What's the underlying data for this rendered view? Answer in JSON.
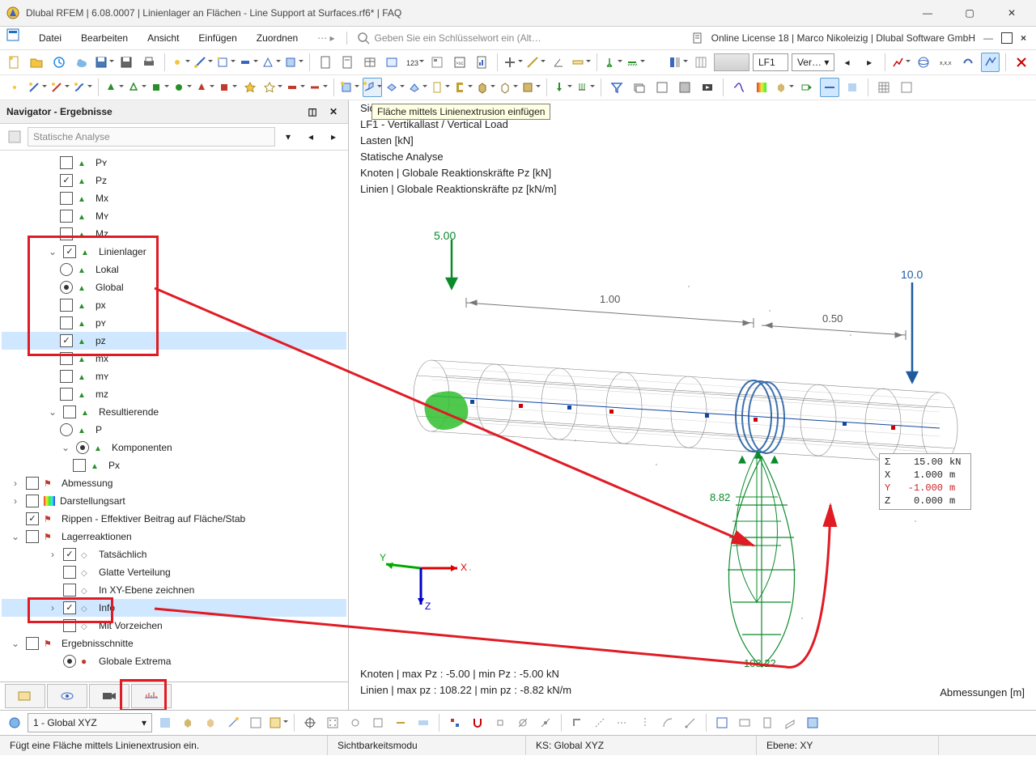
{
  "title": "Dlubal RFEM | 6.08.0007 | Linienlager an Flächen - Line Support at Surfaces.rf6* | FAQ",
  "menu": [
    "Datei",
    "Bearbeiten",
    "Ansicht",
    "Einfügen",
    "Zuordnen"
  ],
  "search_placeholder": "Geben Sie ein Schlüsselwort ein (Alt…",
  "license": "Online License 18 | Marco Nikoleizig | Dlubal Software GmbH",
  "tooltip": "Fläche mittels Linienextrusion einfügen",
  "lf_label": "LF1",
  "lf_value": "Ver…",
  "navigator": {
    "title": "Navigator - Ergebnisse",
    "combo": "Statische Analyse",
    "items": {
      "py": "Pʏ",
      "pz": "Pᴢ",
      "mx": "Mx",
      "my": "Mʏ",
      "mz": "Mᴢ",
      "linienlager": "Linienlager",
      "lokal": "Lokal",
      "global": "Global",
      "spx": "px",
      "spy": "pʏ",
      "spz": "pᴢ",
      "smx": "mx",
      "smy": "mʏ",
      "smz": "mᴢ",
      "resultierende": "Resultierende",
      "p": "P",
      "komponenten": "Komponenten",
      "pxk": "Px",
      "abmessung": "Abmessung",
      "darstellungsart": "Darstellungsart",
      "rippen": "Rippen - Effektiver Beitrag auf Fläche/Stab",
      "lagerreaktionen": "Lagerreaktionen",
      "tatsaechlich": "Tatsächlich",
      "glatte": "Glatte Verteilung",
      "inxy": "In XY-Ebene zeichnen",
      "info": "Info",
      "mitvor": "Mit Vorzeichen",
      "ergebnisschnitte": "Ergebnisschnitte",
      "globext": "Globale Extrema"
    }
  },
  "viewport": {
    "lines": [
      "Sichtbarkeitsmodus",
      "LF1 - Vertikallast / Vertical Load",
      "Lasten [kN]",
      "Statische Analyse",
      "Knoten | Globale Reaktionskräfte Pᴢ [kN]",
      "Linien | Globale Reaktionskräfte pᴢ [kN/m]"
    ],
    "load_left": "5.00",
    "load_right": "10.0",
    "dim1": "1.00",
    "dim2": "0.50",
    "reaction_left": "8.82",
    "reaction_right": "108.22",
    "valbox": [
      {
        "l": "Σ",
        "n": "15.00",
        "u": "kN",
        "cls": ""
      },
      {
        "l": "X",
        "n": "1.000",
        "u": "m",
        "cls": ""
      },
      {
        "l": "Y",
        "n": "-1.000",
        "u": "m",
        "cls": "red"
      },
      {
        "l": "Z",
        "n": "0.000",
        "u": "m",
        "cls": ""
      }
    ],
    "bottom_lines": [
      "Knoten | max Pᴢ : -5.00 | min Pᴢ : -5.00 kN",
      "Linien | max pᴢ : 108.22 | min pᴢ : -8.82 kN/m"
    ],
    "corner": "Abmessungen [m]"
  },
  "bottom_combo": "1 - Global XYZ",
  "status": {
    "hint": "Fügt eine Fläche mittels Linienextrusion ein.",
    "mode": "Sichtbarkeitsmodu",
    "ks": "KS: Global XYZ",
    "ebene": "Ebene: XY"
  }
}
